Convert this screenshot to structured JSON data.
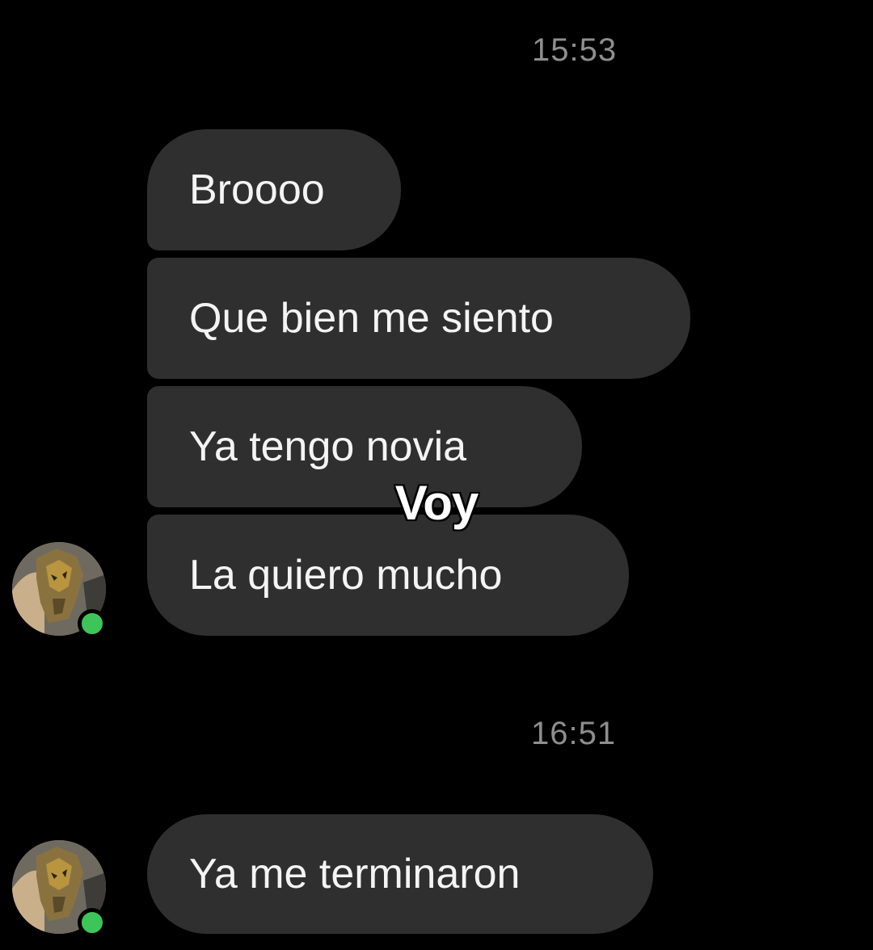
{
  "chat": {
    "groups": [
      {
        "timestamp": "15:53",
        "messages": [
          {
            "text": "Broooo"
          },
          {
            "text": "Que bien me siento"
          },
          {
            "text": "Ya tengo novia"
          },
          {
            "text": "La quiero mucho"
          }
        ]
      },
      {
        "timestamp": "16:51",
        "messages": [
          {
            "text": "Ya me terminaron"
          }
        ]
      }
    ]
  },
  "overlay": {
    "caption": "Voy"
  },
  "colors": {
    "background": "#000000",
    "bubble": "#2f2f2f",
    "bubble_text": "#f4f4f4",
    "timestamp": "#8e8e8e",
    "online_status": "#3ec55a"
  },
  "icons": {
    "avatar": "contact-avatar",
    "presence": "online-status-dot"
  }
}
